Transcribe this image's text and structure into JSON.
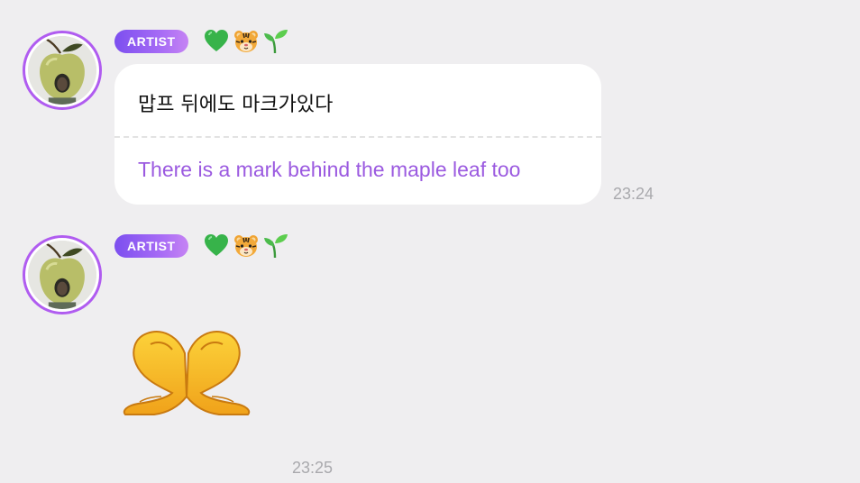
{
  "messages": [
    {
      "author_badge": "ARTIST",
      "badge_color": "#a56af5",
      "reaction_emojis": [
        "green-heart",
        "tiger-face",
        "seedling"
      ],
      "original_text": "맙프 뒤에도 마크가있다",
      "translation_text": "There is a mark behind the maple leaf too",
      "translation_color": "#9b5ae0",
      "time": "23:24"
    },
    {
      "author_badge": "ARTIST",
      "badge_color": "#a56af5",
      "reaction_emojis": [
        "green-heart",
        "tiger-face",
        "seedling"
      ],
      "sticker": "heart-hands-emoji",
      "time": "23:25"
    }
  ]
}
